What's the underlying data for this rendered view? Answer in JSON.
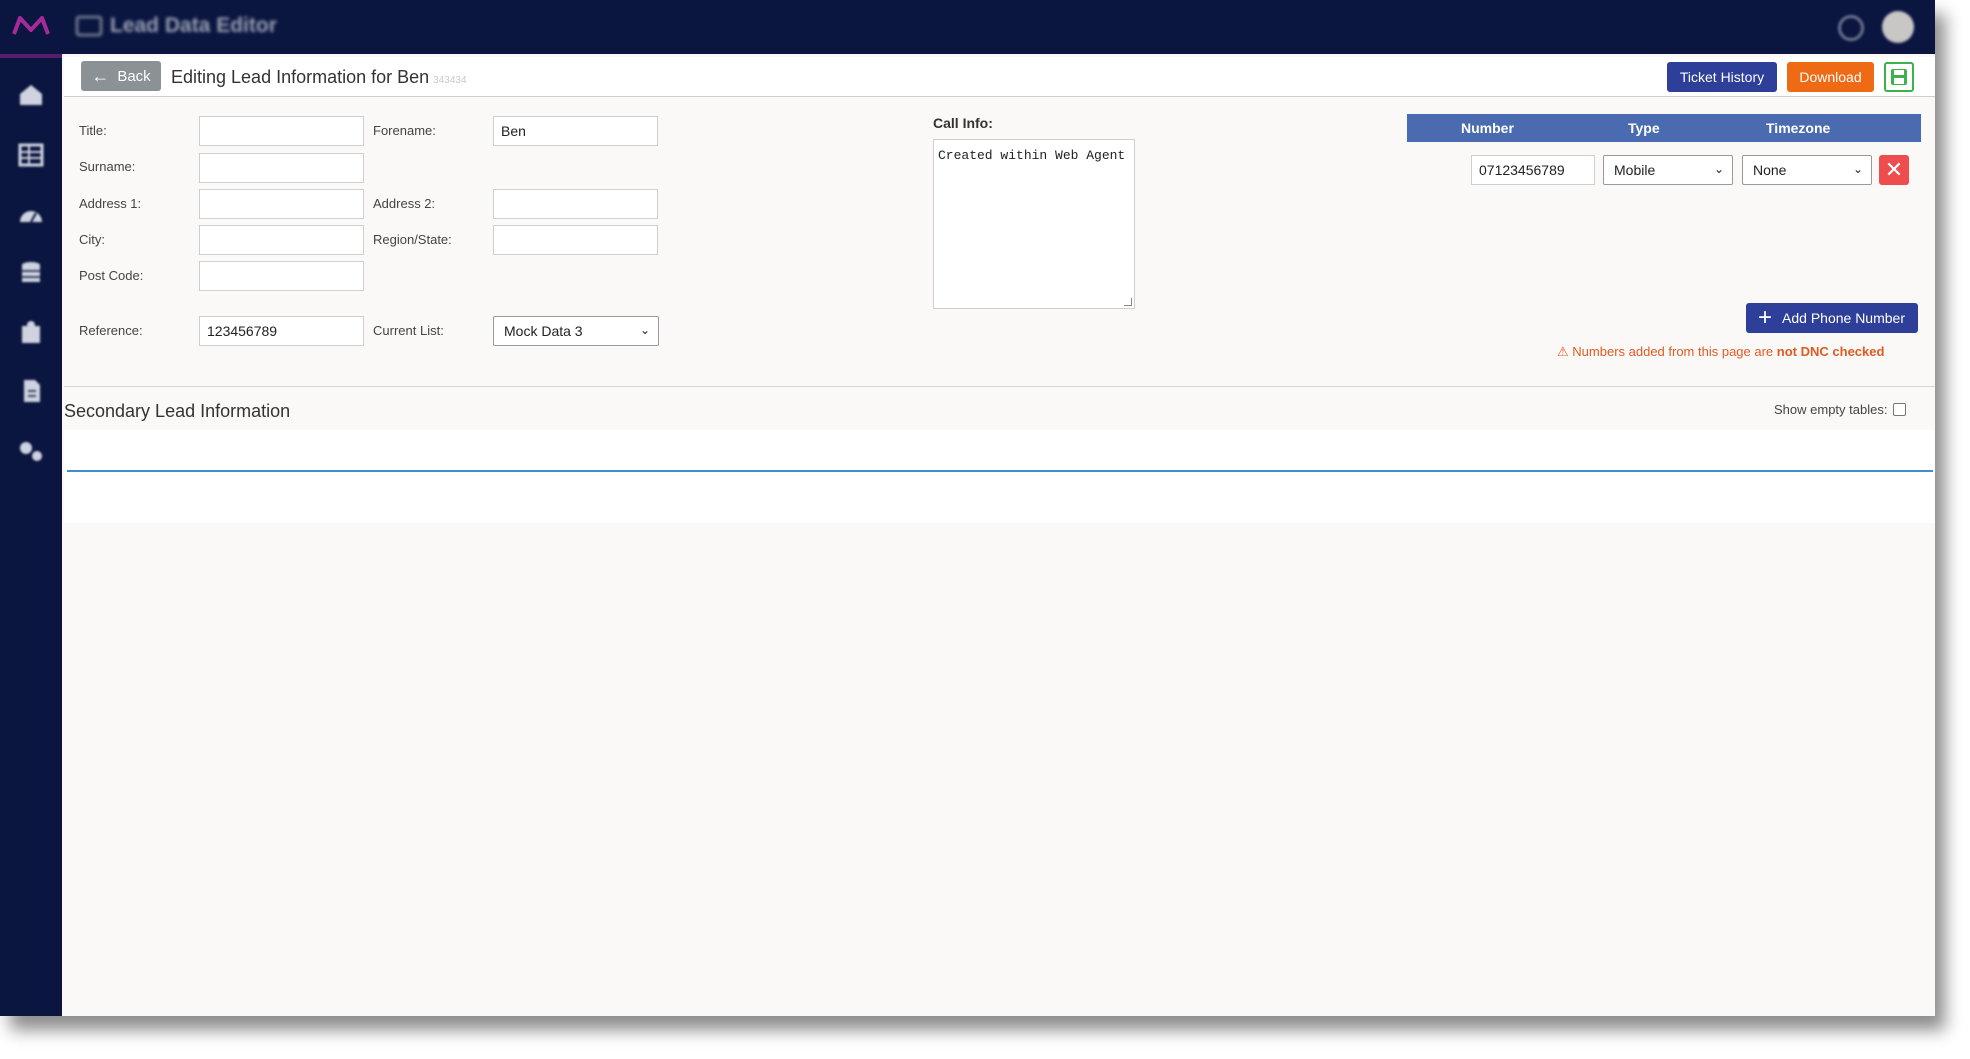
{
  "app": {
    "title": "Lead Data Editor",
    "accent": "#0b1640"
  },
  "sidebar": {
    "items": [
      {
        "icon": "home-icon"
      },
      {
        "icon": "grid-icon"
      },
      {
        "icon": "dashboard-icon"
      },
      {
        "icon": "database-icon"
      },
      {
        "icon": "contacts-icon"
      },
      {
        "icon": "document-icon"
      },
      {
        "icon": "settings-icon"
      }
    ]
  },
  "header": {
    "back_label": "Back",
    "title": "Editing Lead Information for Ben",
    "title_suffix": "343434",
    "ticket_history_label": "Ticket History",
    "download_label": "Download"
  },
  "form": {
    "title": {
      "label": "Title:",
      "value": ""
    },
    "forename": {
      "label": "Forename:",
      "value": "Ben"
    },
    "surname": {
      "label": "Surname:",
      "value": ""
    },
    "address1": {
      "label": "Address 1:",
      "value": ""
    },
    "address2": {
      "label": "Address 2:",
      "value": ""
    },
    "city": {
      "label": "City:",
      "value": ""
    },
    "region": {
      "label": "Region/State:",
      "value": ""
    },
    "postcode": {
      "label": "Post Code:",
      "value": ""
    },
    "reference": {
      "label": "Reference:",
      "value": "123456789"
    },
    "current_list": {
      "label": "Current List:",
      "value": "Mock Data 3"
    }
  },
  "call_info": {
    "label": "Call Info:",
    "value": "Created within Web Agent"
  },
  "phones": {
    "columns": [
      "Number",
      "Type",
      "Timezone"
    ],
    "rows": [
      {
        "number": "07123456789",
        "type": "Mobile",
        "timezone": "None"
      }
    ],
    "add_label": "Add Phone Number",
    "warning_prefix": "Numbers added from this page are",
    "warning_bold": "not DNC checked"
  },
  "secondary": {
    "title": "Secondary Lead Information",
    "show_empty_label": "Show empty tables:"
  }
}
